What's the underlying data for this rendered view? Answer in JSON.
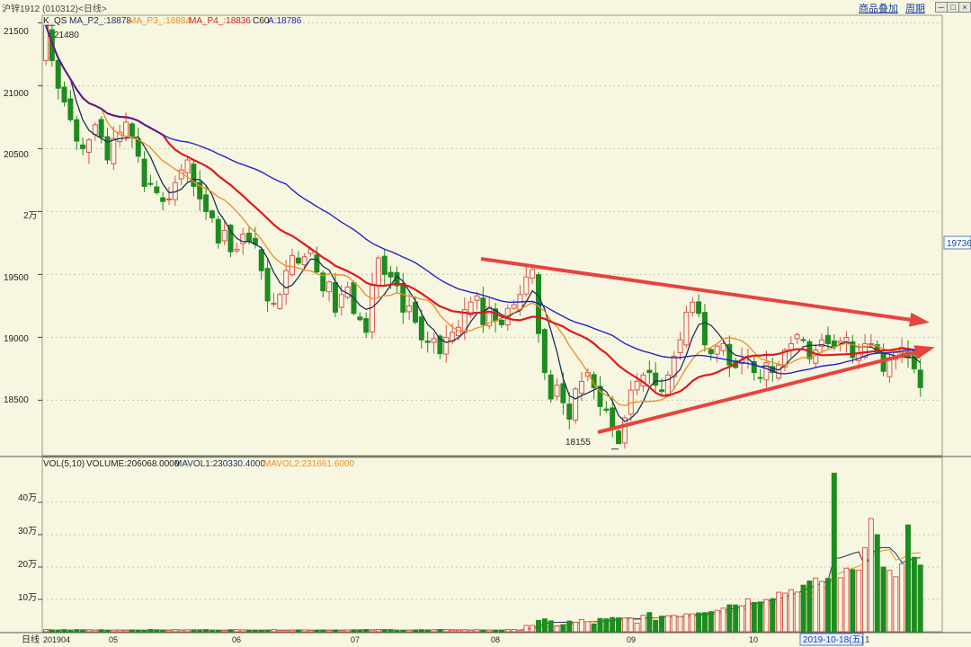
{
  "header": {
    "title": "沪锌1912 (010312)<日线>",
    "link1": "商品叠加",
    "link2": "周期",
    "btn_min": "─",
    "btn_max": "□",
    "btn_close": "×"
  },
  "main_legend": {
    "k": "K",
    "qs": "QS",
    "ma2": "MA_P2_:18878",
    "ma3": "MA_P3_:18884",
    "ma4": "MA_P4_:18836",
    "c60": "C60",
    "a": "A:18786"
  },
  "vol_legend": {
    "vol": "VOL(5,10)",
    "volume": "VOLUME:206068.0000",
    "mavol1": "MAVOL1:230330.4000",
    "mavol2": "MAVOL2:231661.6000"
  },
  "price_axis": [
    "21500",
    "21000",
    "20500",
    "2万",
    "19500",
    "19000",
    "18500"
  ],
  "vol_axis": [
    "40万",
    "30万",
    "20万",
    "10万"
  ],
  "x_axis": {
    "label": "日线",
    "months": [
      "201904",
      "05",
      "06",
      "07",
      "08",
      "09",
      "10"
    ],
    "current_date": "2019-10-18(五)",
    "trail": "1"
  },
  "annotations": {
    "high": "21480",
    "low": "18155",
    "right_price": "19736"
  },
  "colors": {
    "up": "#d9534f",
    "down": "#1e8c1e",
    "ma2": "#1d2f5c",
    "ma3": "#ef8c1e",
    "ma4": "#e0191b",
    "a": "#2323c8",
    "arrow": "#e8433f"
  },
  "chart_data": {
    "type": "candlestick",
    "price_ylim": [
      18060,
      21560
    ],
    "volume_unit": "万",
    "volume_ylim": [
      0,
      50
    ],
    "candles_start": [
      21480,
      20760,
      20700,
      20720
    ],
    "closes": [
      21480,
      21200,
      20980,
      20870,
      20730,
      20560,
      20500,
      20570,
      20690,
      20590,
      20410,
      20580,
      20630,
      20710,
      20600,
      20440,
      20200,
      20220,
      20150,
      20080,
      20100,
      20230,
      20330,
      20410,
      20200,
      20100,
      20000,
      19950,
      19750,
      19850,
      19680,
      19700,
      19820,
      19760,
      19740,
      19530,
      19290,
      19270,
      19340,
      19530,
      19650,
      19590,
      19640,
      19700,
      19520,
      19370,
      19440,
      19200,
      19340,
      19400,
      19190,
      19140,
      19040,
      19420,
      19630,
      19500,
      19480,
      19410,
      19200,
      19250,
      19120,
      18980,
      18960,
      18990,
      18870,
      19000,
      19040,
      19080,
      19220,
      19280,
      19330,
      19100,
      19240,
      19130,
      19100,
      19230,
      19260,
      19340,
      19480,
      19540,
      19030,
      18720,
      18510,
      18620,
      18480,
      18350,
      18590,
      18650,
      18720,
      18600,
      18450,
      18420,
      18270,
      18155,
      18360,
      18580,
      18650,
      18700,
      18720,
      18620,
      18570,
      18700,
      18850,
      18980,
      19200,
      19280,
      19190,
      18940,
      18870,
      18930,
      18950,
      18780,
      18760,
      18820,
      18850,
      18720,
      18680,
      18800,
      18720,
      18780,
      18900,
      18950,
      19020,
      18980,
      18830,
      18900,
      18980,
      18950,
      18930,
      18970,
      19000,
      18840,
      18870,
      18950,
      18950,
      18880,
      18730,
      18820,
      18880,
      18920,
      18840,
      18750,
      18600
    ],
    "highs_note": "high 21480, low 18155",
    "volume_last10": [
      26,
      35,
      30,
      20,
      19,
      17,
      21,
      33,
      23,
      20.6
    ],
    "volume_max_bar": 49,
    "ma_last": {
      "MA_P2_": 18878,
      "MA_P3_": 18884,
      "MA_P4_": 18836,
      "A": 18786
    },
    "mavol_last": {
      "MAVOL1": 23.03,
      "MAVOL2": 23.17
    }
  }
}
